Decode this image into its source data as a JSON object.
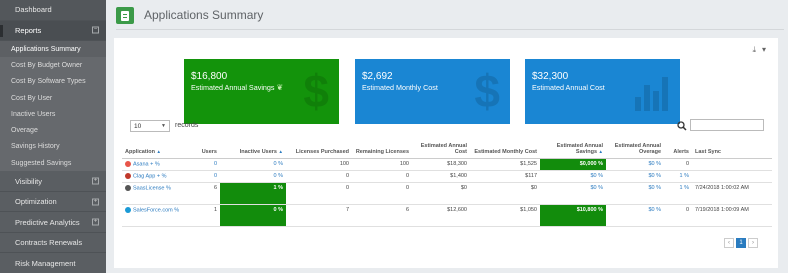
{
  "sidebar": {
    "dashboard": "Dashboard",
    "reports": "Reports",
    "sub_items": [
      "Applications Summary",
      "Cost By Budget Owner",
      "Cost By Software Types",
      "Cost By User",
      "Inactive Users",
      "Overage",
      "Savings History",
      "Suggested Savings"
    ],
    "visibility": "Visibility",
    "optimization": "Optimization",
    "predictive": "Predictive Analytics",
    "contracts": "Contracts Renewals",
    "risk": "Risk Management"
  },
  "header": {
    "title": "Applications Summary"
  },
  "tiles": [
    {
      "value": "$16,800",
      "label": "Estimated Annual Savings"
    },
    {
      "value": "$2,692",
      "label": "Estimated Monthly Cost"
    },
    {
      "value": "$32,300",
      "label": "Estimated Annual Cost"
    }
  ],
  "table_controls": {
    "page_length": "10",
    "records_label": "records"
  },
  "table": {
    "headers": [
      "Application",
      "Users",
      "Inactive Users",
      "Licenses Purchased",
      "Remaining Licenses",
      "Estimated Annual Cost",
      "Estimated Monthly Cost",
      "Estimated Annual Savings",
      "Estimated Annual Overage",
      "Alerts",
      "Last Sync"
    ],
    "rows": [
      [
        "Asana + %",
        "0",
        "0 %",
        "100",
        "100",
        "$18,300",
        "$1,525",
        "$0,000 %",
        "$0 %",
        "0",
        ""
      ],
      [
        "Clag App + %",
        "0",
        "0 %",
        "0",
        "0",
        "$1,400",
        "$117",
        "$0 %",
        "$0 %",
        "1 %",
        ""
      ],
      [
        "SaasLicense %",
        "6",
        "1 %",
        "0",
        "0",
        "$0",
        "$0",
        "$0 %",
        "$0 %",
        "1 %",
        "7/24/2018 1:00:02 AM"
      ],
      [
        "SalesForce.com %",
        "1",
        "0 %",
        "7",
        "6",
        "$12,600",
        "$1,050",
        "$10,800 %",
        "$0 %",
        "0",
        "7/19/2018 1:00:09 AM"
      ]
    ]
  },
  "pager": {
    "prev": "‹",
    "current": "1",
    "next": "›"
  },
  "colors": {
    "green": "#13930b",
    "blue": "#1a86d3",
    "sidebar": "#5a5e62"
  }
}
